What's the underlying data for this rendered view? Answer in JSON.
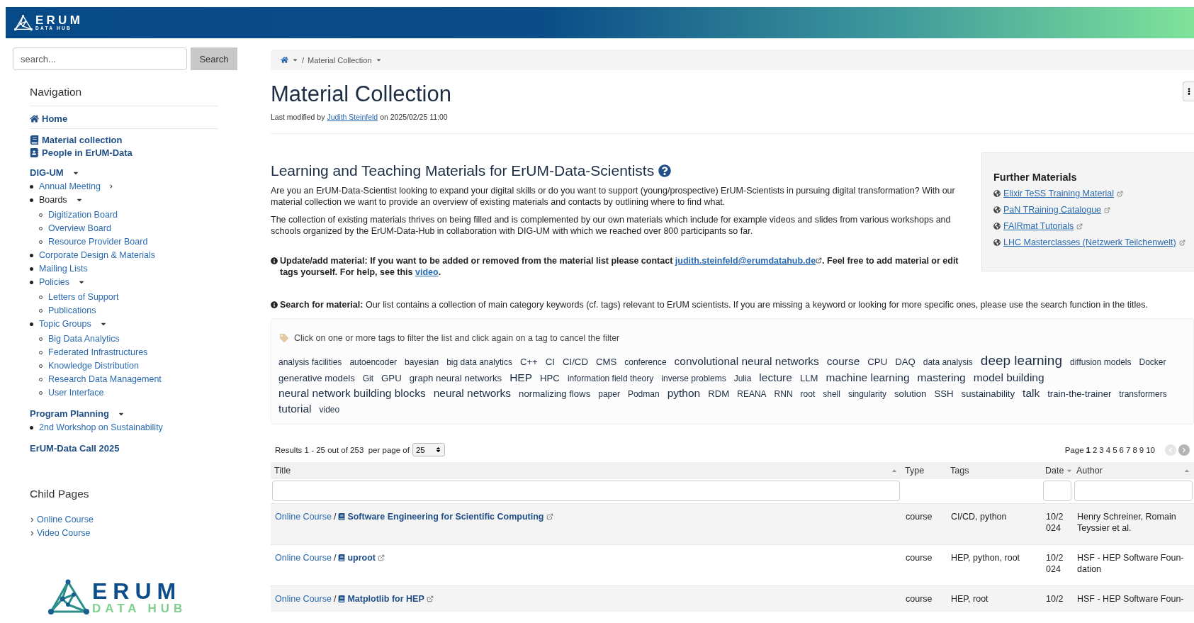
{
  "header": {
    "logo_word": "ERUM",
    "logo_sub": "DATA HUB"
  },
  "sidebar": {
    "search": {
      "placeholder": "search...",
      "button": "Search"
    },
    "nav_title": "Navigation",
    "nav": [
      {
        "label": "Home",
        "kind": "home"
      },
      {
        "label": "Material collection",
        "kind": "book"
      },
      {
        "label": "People in ErUM-Data",
        "kind": "contact"
      }
    ],
    "sections": [
      {
        "label": "DIG-UM",
        "expanded": true,
        "items": [
          {
            "label": "Annual Meeting",
            "kind": "link",
            "expanded": false
          },
          {
            "label": "Boards",
            "kind": "label",
            "expanded": true,
            "children": [
              {
                "label": "Digitization Board"
              },
              {
                "label": "Overview Board"
              },
              {
                "label": "Resource Provider Board"
              }
            ]
          },
          {
            "label": "Corporate Design & Materials",
            "kind": "link"
          },
          {
            "label": "Mailing Lists",
            "kind": "link"
          },
          {
            "label": "Policies",
            "kind": "link",
            "expanded": true,
            "children": [
              {
                "label": "Letters of Support"
              },
              {
                "label": "Publications"
              }
            ]
          },
          {
            "label": "Topic Groups",
            "kind": "link",
            "expanded": true,
            "children": [
              {
                "label": "Big Data Analytics"
              },
              {
                "label": "Federated Infrastructures"
              },
              {
                "label": "Knowledge Distribution"
              },
              {
                "label": "Research Data Management"
              },
              {
                "label": "User Interface"
              }
            ]
          }
        ]
      },
      {
        "label": "Program Planning",
        "expanded": true,
        "items": [
          {
            "label": "2nd Workshop on Sustainability",
            "kind": "link"
          }
        ]
      },
      {
        "label": "ErUM-Data Call 2025"
      }
    ],
    "child_pages": {
      "title": "Child Pages",
      "items": [
        "Online Course",
        "Video Course"
      ]
    },
    "footer_logo": {
      "word": "ERUM",
      "sub": "DATA HUB"
    }
  },
  "main": {
    "breadcrumb_separator": "/",
    "breadcrumb": [
      "Material Collection"
    ],
    "title": "Material Collection",
    "modified": {
      "prefix": "Last modified by",
      "author": "Judith Steinfeld",
      "suffix": "on 2025/02/25 11:00"
    },
    "heading": "Learning and Teaching Materials for ErUM-Data-Scientists",
    "paragraphs": [
      "Are you an ErUM-Data-Scientist looking to expand your digital skills or do you want to support (young/prospective) ErUM-Scientists in pursuing digital transformation? With our material collection we want to provide an overview of existing materials and contacts by outlining where to find what.",
      "The collection of existing materials thrives on being filled and is complemented by our own materials which include for example videos and slides from various workshops and schools organized by the ErUM-Data-Hub in collaboration with DIG-UM with which we reached over 800 participants so far."
    ],
    "further": {
      "title": "Further Materials",
      "links": [
        "Elixir TeSS Training Material",
        "PaN TRaining Catalogue",
        "FAIRmat Tutorials",
        "LHC Masterclasses (Netzwerk Teilchenwelt)"
      ]
    },
    "update_note": {
      "label": "Update/add material:",
      "text1": "If you want to be added or removed from the material list please contact",
      "email": "judith.steinfeld@erumdatahub.de",
      "text2": ". Feel free to add material or edit tags yourself. For help, see this",
      "link": "video",
      "text3": "."
    },
    "search_note": {
      "label": "Search for material:",
      "text": "Our list contains a collection of main category keywords (cf. tags) relevant to ErUM scientists. If you are missing a keyword or looking for more specific ones, please use the search function in the titles."
    },
    "tags": {
      "hint": "Click on one or more tags to filter the list and click again on a tag to cancel the filter",
      "items": [
        {
          "label": "analysis facilities",
          "kind": "small"
        },
        {
          "label": "autoencoder",
          "kind": "small"
        },
        {
          "label": "bayesian",
          "kind": "small"
        },
        {
          "label": "big data analytics",
          "kind": "small"
        },
        {
          "label": "C++",
          "kind": "medium"
        },
        {
          "label": "CI",
          "kind": "medium"
        },
        {
          "label": "CI/CD",
          "kind": "medium"
        },
        {
          "label": "CMS",
          "kind": "medium"
        },
        {
          "label": "conference",
          "kind": "small"
        },
        {
          "label": "convolutional neural networks",
          "kind": "large"
        },
        {
          "label": "course",
          "kind": "large"
        },
        {
          "label": "CPU",
          "kind": "medium"
        },
        {
          "label": "DAQ",
          "kind": "medium"
        },
        {
          "label": "data analysis",
          "kind": "small"
        },
        {
          "label": "deep learning",
          "kind": "xlarge"
        },
        {
          "label": "diffusion models",
          "kind": "small"
        },
        {
          "label": "Docker",
          "kind": "small"
        },
        {
          "label": "generative models",
          "kind": "medium"
        },
        {
          "label": "Git",
          "kind": "small"
        },
        {
          "label": "GPU",
          "kind": "medium"
        },
        {
          "label": "graph neural networks",
          "kind": "medium"
        },
        {
          "label": "HEP",
          "kind": "large"
        },
        {
          "label": "HPC",
          "kind": "medium"
        },
        {
          "label": "information field theory",
          "kind": "small"
        },
        {
          "label": "inverse problems",
          "kind": "small"
        },
        {
          "label": "Julia",
          "kind": "small"
        },
        {
          "label": "lecture",
          "kind": "large"
        },
        {
          "label": "LLM",
          "kind": "medium"
        },
        {
          "label": "machine learning",
          "kind": "large"
        },
        {
          "label": "mastering",
          "kind": "large"
        },
        {
          "label": "model building",
          "kind": "large"
        },
        {
          "label": "neural network building blocks",
          "kind": "large"
        },
        {
          "label": "neural networks",
          "kind": "large"
        },
        {
          "label": "normalizing flows",
          "kind": "medium"
        },
        {
          "label": "paper",
          "kind": "small"
        },
        {
          "label": "Podman",
          "kind": "small"
        },
        {
          "label": "python",
          "kind": "large"
        },
        {
          "label": "RDM",
          "kind": "medium"
        },
        {
          "label": "REANA",
          "kind": "small"
        },
        {
          "label": "RNN",
          "kind": "small"
        },
        {
          "label": "root",
          "kind": "small"
        },
        {
          "label": "shell",
          "kind": "small"
        },
        {
          "label": "singularity",
          "kind": "small"
        },
        {
          "label": "solution",
          "kind": "medium"
        },
        {
          "label": "SSH",
          "kind": "medium"
        },
        {
          "label": "sustainability",
          "kind": "medium"
        },
        {
          "label": "talk",
          "kind": "large"
        },
        {
          "label": "train-the-trainer",
          "kind": "medium"
        },
        {
          "label": "transformers",
          "kind": "small"
        },
        {
          "label": "tutorial",
          "kind": "large"
        },
        {
          "label": "video",
          "kind": "small"
        }
      ]
    },
    "results": {
      "summary": "Results 1 - 25 out of 253",
      "per_page_label": "per page of",
      "per_page": "25",
      "page_label": "Page",
      "pages": [
        {
          "label": "1",
          "selected": true
        },
        {
          "label": "2",
          "selected": false
        },
        {
          "label": "3",
          "selected": false
        },
        {
          "label": "4",
          "selected": false
        },
        {
          "label": "5",
          "selected": false
        },
        {
          "label": "6",
          "selected": false
        },
        {
          "label": "7",
          "selected": false
        },
        {
          "label": "8",
          "selected": false
        },
        {
          "label": "9",
          "selected": false
        },
        {
          "label": "10",
          "selected": false
        }
      ],
      "prev_disabled": true,
      "next_disabled": false
    },
    "table": {
      "columns": [
        {
          "label": "Title",
          "sorted": true,
          "ascending": true,
          "filter": true
        },
        {
          "label": "Type",
          "sorted": false,
          "filter": false
        },
        {
          "label": "Tags",
          "sorted": false,
          "filter": false
        },
        {
          "label": "Date",
          "sorted": true,
          "ascending": false,
          "filter": true
        },
        {
          "label": "Author",
          "sorted": true,
          "ascending": true,
          "filter": true
        }
      ],
      "rows": [
        {
          "category": "Online Course",
          "separator": "/",
          "title": "Software Engineering for Scientific Computing",
          "type": "course",
          "tags": "CI/CD, python",
          "date": "10/2024",
          "author": "Henry Schreiner, Romain Teyssier et al."
        },
        {
          "category": "Online Course",
          "separator": "/",
          "title": "uproot",
          "type": "course",
          "tags": "HEP, python, root",
          "date": "10/2024",
          "author": "HSF - HEP Software Foun-dation"
        },
        {
          "category": "Online Course",
          "separator": "/",
          "title": "Matplotlib for HEP",
          "type": "course",
          "tags": "HEP, root",
          "date": "10/2",
          "author": "HSF - HEP Software Foun-"
        }
      ]
    }
  }
}
